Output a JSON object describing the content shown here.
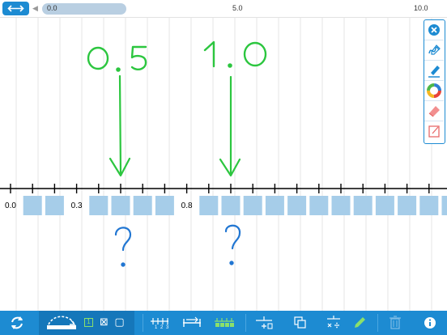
{
  "top_bar": {
    "range_start": "0.0",
    "range_mid": "5.0",
    "range_end": "10.0",
    "scroll_left_arrow": "◀"
  },
  "number_line": {
    "labels": [
      {
        "text": "0.0",
        "position": 0.0
      },
      {
        "text": "0.3",
        "position": 0.3
      },
      {
        "text": "0.8",
        "position": 0.8
      }
    ],
    "tick_spacing": 0.1,
    "hidden_box_positions": [
      0.1,
      0.2,
      0.4,
      0.5,
      0.6,
      0.7,
      0.9,
      1.0,
      1.1,
      1.2,
      1.3,
      1.4,
      1.5,
      1.6,
      1.7,
      1.8,
      1.9,
      2.0
    ]
  },
  "annotations": {
    "green_labels": [
      "0.5",
      "1.0"
    ],
    "blue_marks": [
      "?",
      "?"
    ]
  },
  "palette": {
    "items": [
      "close-icon",
      "pen-icon",
      "highlighter-icon",
      "color-wheel-icon",
      "eraser-icon",
      "note-icon"
    ]
  },
  "toolbar": {
    "mode_boxes": [
      "1",
      "⊠",
      "▢"
    ],
    "ruler_labels": "1 2 3"
  },
  "colors": {
    "accent": "#1d8bd2",
    "box_fill": "#a6cde9",
    "ink_green": "#2cc63f",
    "ink_blue": "#2176d2",
    "grid": "#e4e4e4"
  }
}
